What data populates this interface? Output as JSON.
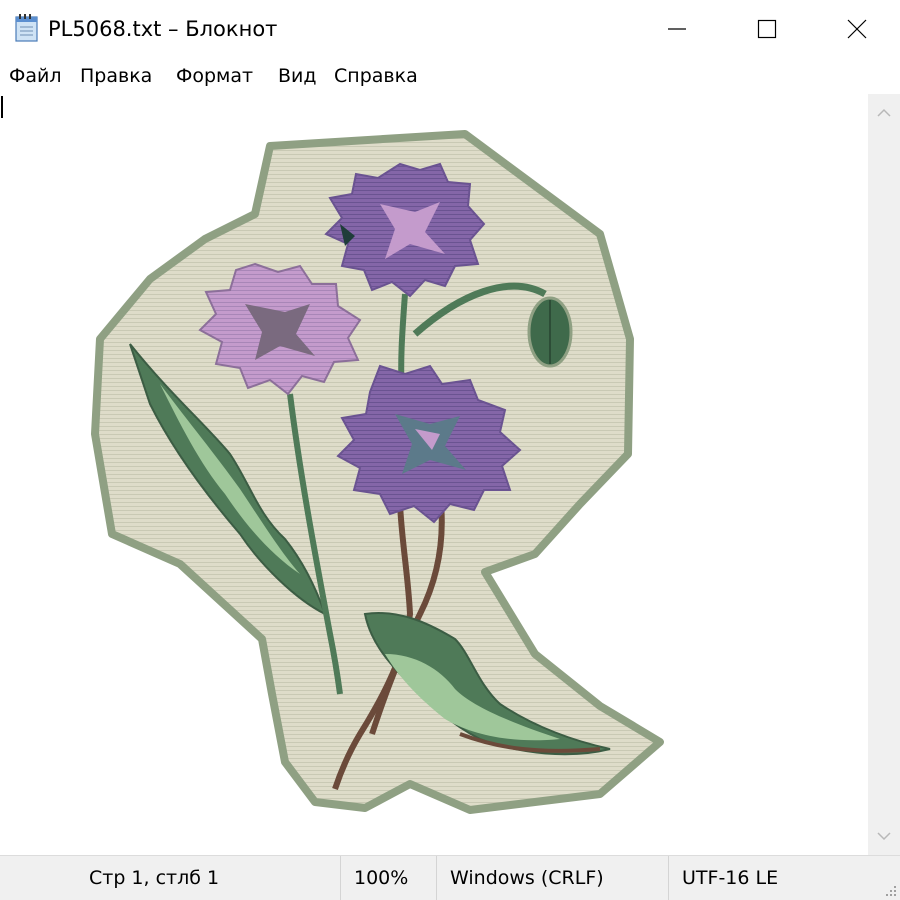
{
  "window": {
    "title": "PL5068.txt – Блокнот"
  },
  "menu": {
    "items": [
      "Файл",
      "Правка",
      "Формат",
      "Вид",
      "Справка"
    ]
  },
  "statusbar": {
    "position": "Стр 1, стлб 1",
    "zoom": "100%",
    "line_ending": "Windows (CRLF)",
    "encoding": "UTF-16 LE"
  },
  "colors": {
    "background_patch": "#dedcc9",
    "patch_border": "#8fa083",
    "flower_purple": "#8466a8",
    "flower_pink": "#c49bcc",
    "leaf_green": "#4f7a58",
    "leaf_light": "#9fc79a",
    "stem": "#6b4a3a"
  },
  "icons": {
    "app": "notepad-icon",
    "minimize": "minimize-icon",
    "maximize": "maximize-icon",
    "close": "close-icon",
    "scroll_up": "chevron-up-icon",
    "scroll_down": "chevron-down-icon",
    "resize": "resize-grip-icon"
  }
}
